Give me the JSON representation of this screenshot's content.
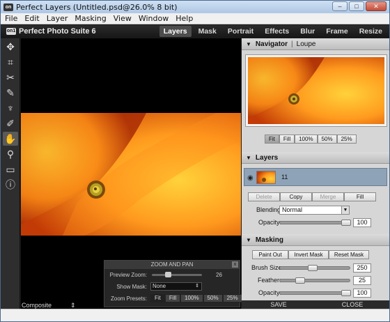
{
  "window": {
    "title": "Perfect Layers (Untitled.psd@26.0% 8 bit)",
    "minimize": "–",
    "maximize": "□",
    "close": "✕"
  },
  "menu": [
    "File",
    "Edit",
    "Layer",
    "Masking",
    "View",
    "Window",
    "Help"
  ],
  "brand": {
    "logo": "on1",
    "name": "Perfect Photo Suite 6"
  },
  "modules": [
    "Layers",
    "Mask",
    "Portrait",
    "Effects",
    "Blur",
    "Frame",
    "Resize"
  ],
  "active_module": "Layers",
  "tools": [
    "move-icon",
    "crop-icon",
    "scissors-icon",
    "brush-icon",
    "retouch-icon",
    "eyedropper-icon",
    "hand-icon",
    "zoom-icon",
    "view-mode-icon",
    "info-icon"
  ],
  "zoom_pan": {
    "title": "ZOOM AND PAN",
    "close": "x",
    "preview_zoom_label": "Preview Zoom:",
    "preview_zoom_value": "26",
    "preview_zoom_fraction": 0.3,
    "show_mask_label": "Show Mask:",
    "show_mask_value": "None",
    "zoom_presets_label": "Zoom Presets:",
    "presets": [
      "Fit",
      "Fill",
      "100%",
      "50%",
      "25%"
    ]
  },
  "composite": {
    "label": "Composite",
    "arrow": "⇕"
  },
  "navigator": {
    "title": "Navigator",
    "alt_title": "Loupe",
    "presets": [
      "Fit",
      "Fill",
      "100%",
      "50%",
      "25%"
    ]
  },
  "layers": {
    "title": "Layers",
    "layer_name": "11",
    "buttons": [
      "Delete",
      "Copy",
      "Merge",
      "Fill"
    ],
    "blending_label": "Blending:",
    "blending_value": "Normal",
    "opacity_label": "Opacity:",
    "opacity_value": "100",
    "opacity_fraction": 1.0
  },
  "masking": {
    "title": "Masking",
    "buttons": [
      "Paint Out",
      "Invert Mask",
      "Reset Mask"
    ],
    "brush_size_label": "Brush Size:",
    "brush_size_value": "250",
    "brush_size_fraction": 0.45,
    "feather_label": "Feather:",
    "feather_value": "25",
    "feather_fraction": 0.25,
    "opacity_label": "Opacity:",
    "opacity_value": "100",
    "opacity_fraction": 1.0
  },
  "footer": {
    "save": "SAVE",
    "close": "CLOSE"
  }
}
